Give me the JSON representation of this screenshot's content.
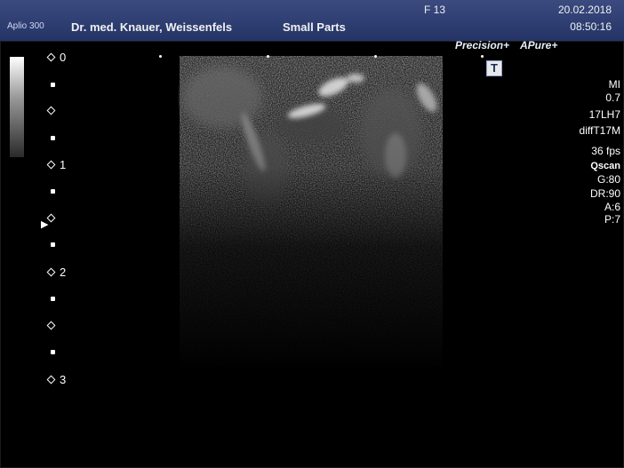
{
  "header": {
    "device": "Aplio 300",
    "physician": "Dr. med. Knauer, Weissenfels",
    "preset": "Small Parts",
    "frame": "F  13",
    "date": "20.02.2018",
    "time": "08:50:16"
  },
  "logos": {
    "precision": "Precision+",
    "apure": "APure+"
  },
  "transducer_icon": "T",
  "depth_scale": {
    "labels": [
      "0",
      "1",
      "2",
      "3"
    ],
    "focus_marker": "▶"
  },
  "params": {
    "mi_label": "MI",
    "mi_value": "0.7",
    "probe": "17LH7",
    "mode": "diffT17M",
    "fps": "36 fps",
    "qscan": "Qscan",
    "gain": "G:80",
    "dr": "DR:90",
    "a": "A:6",
    "p": "P:7"
  },
  "colors": {
    "header_bg": "#2c3c72",
    "screen_bg": "#000000",
    "text": "#ffffff"
  }
}
